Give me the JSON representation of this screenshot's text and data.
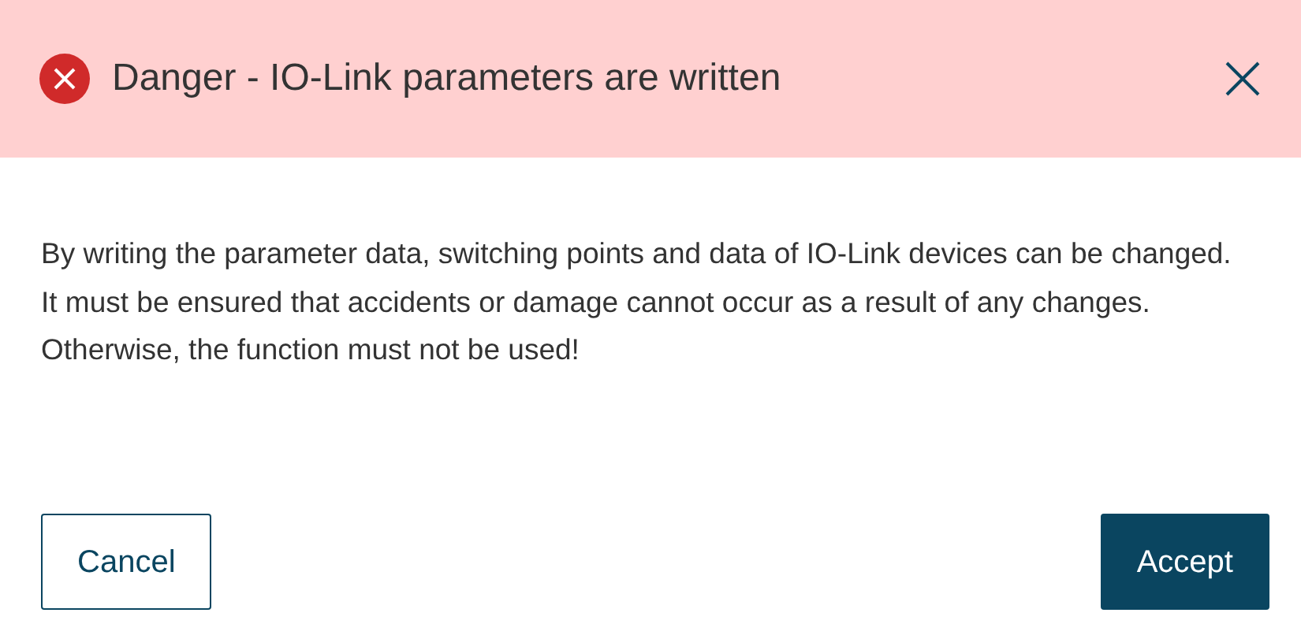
{
  "dialog": {
    "title": "Danger - IO-Link parameters are written",
    "message": "By writing the parameter data, switching points and data of IO-Link devices can be changed. It must be ensured that accidents or damage cannot occur as a result of any changes. Otherwise, the function must not be used!",
    "buttons": [
      {
        "label": "Cancel",
        "kind": "secondary"
      },
      {
        "label": "Accept",
        "kind": "primary"
      }
    ]
  }
}
